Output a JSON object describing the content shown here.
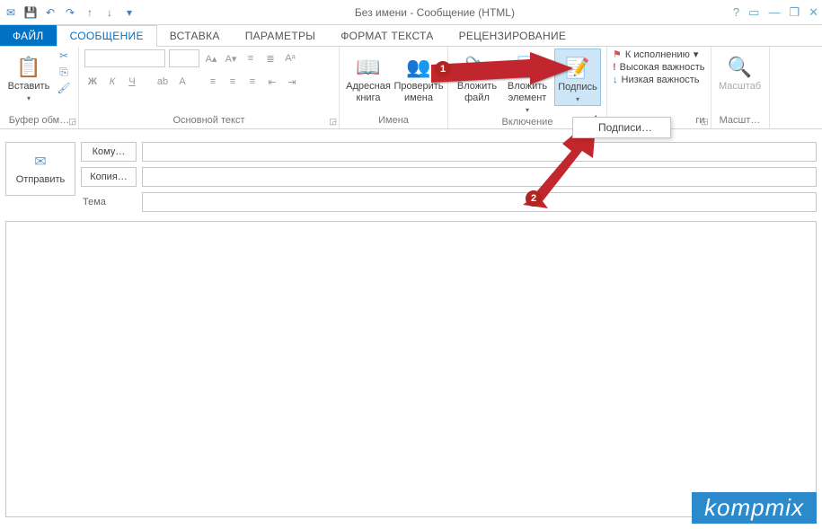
{
  "window": {
    "title": "Без имени - Сообщение (HTML)"
  },
  "qat_icons": {
    "mail": "✉",
    "save": "💾",
    "undo": "↶",
    "redo": "↷",
    "up": "↑",
    "down": "↓",
    "more": "▾"
  },
  "win_icons": {
    "help": "?",
    "ribbon": "▭",
    "min": "—",
    "restore": "❐",
    "close": "✕"
  },
  "tabs": {
    "file": "ФАЙЛ",
    "message": "СООБЩЕНИЕ",
    "insert": "ВСТАВКА",
    "options": "ПАРАМЕТРЫ",
    "format": "ФОРМАТ ТЕКСТА",
    "review": "РЕЦЕНЗИРОВАНИЕ"
  },
  "ribbon": {
    "clipboard": {
      "paste": "Вставить",
      "label": "Буфер обм…"
    },
    "font": {
      "bold": "Ж",
      "italic": "К",
      "underline": "Ч",
      "label": "Основной текст"
    },
    "names": {
      "addressbook": "Адресная книга",
      "checknames": "Проверить имена",
      "label": "Имена"
    },
    "include": {
      "attachfile": "Вложить файл",
      "attachitem": "Вложить элемент",
      "signature": "Подпись",
      "label": "Включение"
    },
    "tags": {
      "followup": "К исполнению",
      "high": "Высокая важность",
      "low": "Низкая важность",
      "label": "ги"
    },
    "zoom": {
      "button": "Масштаб",
      "label": "Масшт…"
    }
  },
  "dropdown": {
    "signatures": "Подписи…"
  },
  "compose": {
    "send": "Отправить",
    "to": "Кому…",
    "cc": "Копия…",
    "subject": "Тема"
  },
  "callouts": {
    "one": "1",
    "two": "2"
  },
  "watermark": "kompmix"
}
